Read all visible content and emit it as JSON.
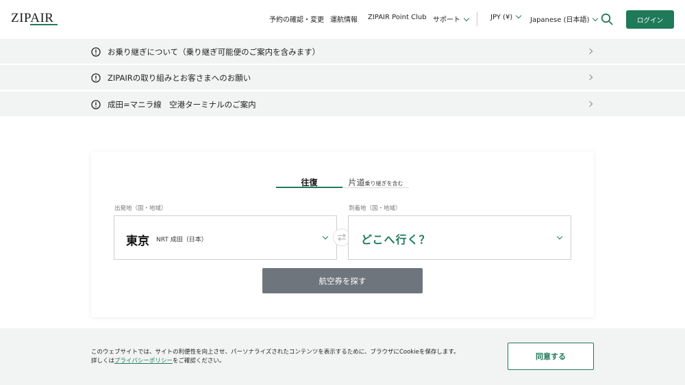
{
  "header": {
    "logo": "ZIPAIR",
    "nav": {
      "manage": "予約の確認・変更",
      "flight_status": "運航情報",
      "point_club": "ZIPAIR Point Club",
      "support": "サポート",
      "currency": "JPY (¥)",
      "language": "Japanese (日本語)"
    },
    "login_label": "ログイン"
  },
  "notices": [
    {
      "text": "お乗り継ぎについて（乗り継ぎ可能便のご案内を含みます）"
    },
    {
      "text": "ZIPAIRの取り組みとお客さまへのお願い"
    },
    {
      "text": "成田=マニラ線　空港ターミナルのご案内"
    }
  ],
  "booking": {
    "tab_round_trip": "往復",
    "tab_one_way": "片道",
    "tab_one_way_note": "乗り継ぎを含む",
    "from_label": "出発地（国・地域）",
    "from_city": "東京",
    "from_detail": "NRT 成田（日本）",
    "to_label": "到着地（国・地域）",
    "to_placeholder": "どこへ行く？",
    "search_label": "航空券を探す"
  },
  "cookie": {
    "line1": "このウェブサイトでは、サイトの利便性を向上させ、パーソナライズされたコンテンツを表示するために、ブラウザにCookieを保存します。",
    "line2_prefix": "詳しくは",
    "privacy_link": "プライバシーポリシー",
    "line2_suffix": "をご確認ください。",
    "agree_label": "同意する"
  },
  "colors": {
    "brand_green": "#1f7a5a",
    "search_button_gray": "#6e757c",
    "notice_bg": "#f2f3f3"
  }
}
